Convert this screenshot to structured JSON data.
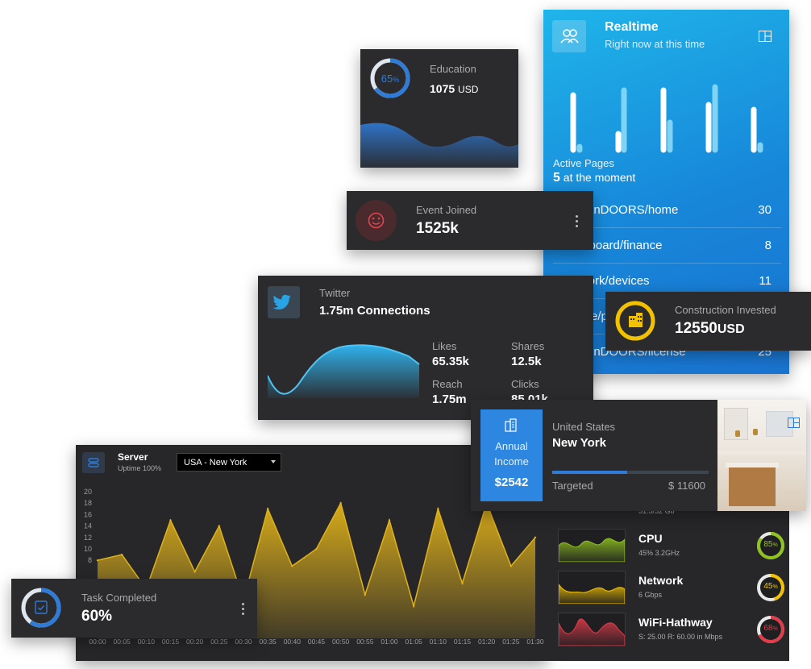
{
  "realtime": {
    "title": "Realtime",
    "subtitle": "Right now at this time",
    "active_label": "Active Pages",
    "active_count": "5",
    "active_suffix": "at the moment",
    "pages": [
      {
        "name": "getWinDOORS/home",
        "count": "30"
      },
      {
        "name": "dashboard/finance",
        "count": "8"
      },
      {
        "name": "network/devices",
        "count": "11"
      },
      {
        "name": "device/p",
        "count": ""
      },
      {
        "name": "getWinDOORS/license",
        "count": "25"
      }
    ]
  },
  "education": {
    "label": "Education",
    "amount": "1075",
    "unit": "USD",
    "percent": "65",
    "percent_unit": "%"
  },
  "event": {
    "label": "Event Joined",
    "value": "1525k"
  },
  "twitter": {
    "label": "Twitter",
    "value": "1.75m Connections",
    "stats": [
      {
        "label": "Likes",
        "value": "65.35k"
      },
      {
        "label": "Shares",
        "value": "12.5k"
      },
      {
        "label": "Reach",
        "value": "1.75m"
      },
      {
        "label": "Clicks",
        "value": "85.01k"
      }
    ]
  },
  "construction": {
    "label": "Construction Invested",
    "value": "12550",
    "unit": "USD"
  },
  "income": {
    "tile_line1": "Annual",
    "tile_line2": "Income",
    "tile_amount": "$2542",
    "country": "United States",
    "city": "New York",
    "target_label": "Targeted",
    "target_value": "$ 11600",
    "progress": 0.48
  },
  "server": {
    "title": "Server",
    "uptime": "Uptime 100%",
    "location": "USA - New York",
    "chart_data": {
      "type": "area",
      "x": [
        "00:00",
        "00:05",
        "00:10",
        "00:15",
        "00:20",
        "00:25",
        "00:30",
        "00:35",
        "00:40",
        "00:45",
        "00:50",
        "00:55",
        "01:00",
        "01:05",
        "01:10",
        "01:15",
        "01:20",
        "01:25",
        "01:30"
      ],
      "values": [
        8,
        9,
        3,
        15,
        6,
        14,
        1,
        17,
        7,
        10,
        18,
        2,
        15,
        0,
        17,
        4,
        18,
        7,
        12
      ],
      "ylim": [
        0,
        20
      ],
      "yticks": [
        "20",
        "18",
        "16",
        "14",
        "12",
        "10",
        "8"
      ],
      "color": "#e0b21a"
    }
  },
  "metrics": [
    {
      "name": "CPU",
      "sub": "45% 3.2GHz",
      "percent": "85",
      "color": "#8fc31f",
      "fill": 0.85
    },
    {
      "name": "Network",
      "sub": "6 Gbps",
      "percent": "45",
      "color": "#f2c200",
      "fill": 0.45
    },
    {
      "name": "WiFi-Hathway",
      "sub": "S: 25.00 R: 60.00 in Mbps",
      "percent": "68",
      "color": "#e23b4a",
      "fill": 0.68
    }
  ],
  "metric_partial_sub": "51.5/52 Gb",
  "task": {
    "label": "Task Completed",
    "value": "60%",
    "fill": 0.6
  }
}
